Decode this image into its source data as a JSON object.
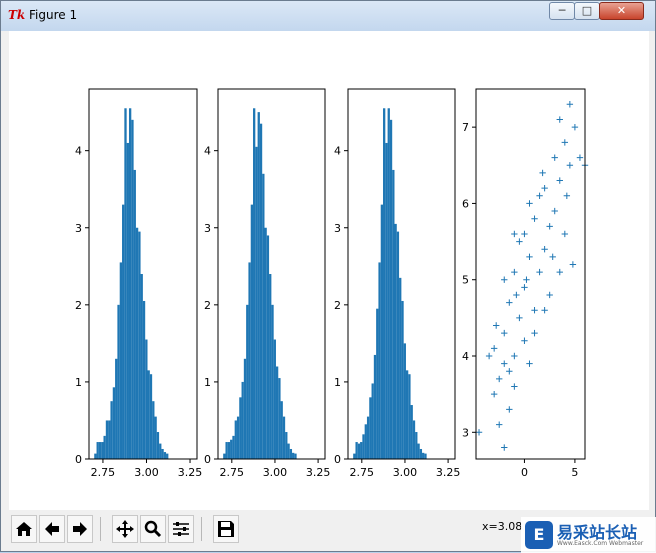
{
  "window": {
    "title": "Figure 1",
    "app_icon": "Tk",
    "buttons": {
      "minimize": "─",
      "maximize": "□",
      "close": "✕"
    }
  },
  "toolbar": {
    "icons": [
      "home-icon",
      "back-arrow-icon",
      "forward-arrow-icon",
      "pan-icon",
      "zoom-icon",
      "configure-subplots-icon",
      "save-icon"
    ],
    "coords": "x=3.08"
  },
  "watermark": {
    "logo": "E",
    "text": "易采站长站",
    "subtext": "Www.Easck.Com Webmaster"
  },
  "colors": {
    "bar": "#1f77b4",
    "marker": "#1f77b4"
  },
  "chart_data": [
    {
      "type": "bar",
      "title": "",
      "xlabel": "",
      "ylabel": "",
      "xlim": [
        2.67,
        3.29
      ],
      "ylim": [
        0,
        4.8
      ],
      "xticks": [
        "2.75",
        "3.00",
        "3.25"
      ],
      "yticks": [
        "0",
        "1",
        "2",
        "3",
        "4"
      ],
      "bin_start": 2.7,
      "bin_width": 0.0133,
      "values": [
        0.07,
        0.22,
        0.22,
        0.22,
        0.3,
        0.5,
        0.5,
        0.75,
        0.93,
        1.3,
        2.0,
        2.55,
        3.3,
        4.55,
        4.1,
        4.55,
        4.4,
        3.75,
        3.0,
        2.95,
        2.4,
        2.05,
        1.55,
        1.15,
        1.1,
        0.75,
        0.55,
        0.35,
        0.2,
        0.13,
        0.09,
        0.07
      ]
    },
    {
      "type": "bar",
      "title": "",
      "xlabel": "",
      "ylabel": "",
      "xlim": [
        2.67,
        3.29
      ],
      "ylim": [
        0,
        4.8
      ],
      "xticks": [
        "2.75",
        "3.00",
        "3.25"
      ],
      "yticks": [
        "0",
        "1",
        "2",
        "3",
        "4"
      ],
      "bin_start": 2.7,
      "bin_width": 0.0133,
      "values": [
        0.07,
        0.22,
        0.22,
        0.25,
        0.3,
        0.5,
        0.55,
        0.8,
        1.0,
        1.3,
        2.0,
        2.55,
        3.3,
        4.55,
        4.05,
        4.5,
        4.35,
        3.7,
        3.0,
        2.9,
        2.4,
        2.0,
        1.55,
        1.2,
        1.05,
        0.75,
        0.55,
        0.35,
        0.2,
        0.13,
        0.08,
        0.07
      ]
    },
    {
      "type": "bar",
      "title": "",
      "xlabel": "",
      "ylabel": "",
      "xlim": [
        2.67,
        3.29
      ],
      "ylim": [
        0,
        4.8
      ],
      "xticks": [
        "2.75",
        "3.00",
        "3.25"
      ],
      "yticks": [
        "0",
        "1",
        "2",
        "3",
        "4"
      ],
      "bin_start": 2.7,
      "bin_width": 0.0133,
      "values": [
        0.07,
        0.22,
        0.2,
        0.22,
        0.32,
        0.45,
        0.55,
        0.8,
        0.98,
        1.35,
        1.95,
        2.55,
        3.3,
        4.55,
        4.1,
        4.55,
        4.4,
        3.75,
        3.05,
        2.95,
        2.35,
        2.05,
        1.5,
        1.15,
        1.1,
        0.7,
        0.5,
        0.35,
        0.2,
        0.13,
        0.08,
        0.07
      ]
    },
    {
      "type": "scatter",
      "title": "",
      "xlabel": "",
      "ylabel": "",
      "marker": "+",
      "xlim": [
        -4.8,
        6.0
      ],
      "ylim": [
        2.65,
        7.5
      ],
      "xticks": [
        "0",
        "5"
      ],
      "yticks": [
        "3",
        "4",
        "5",
        "6",
        "7"
      ],
      "points": [
        [
          -4.5,
          3.0
        ],
        [
          -2.0,
          2.8
        ],
        [
          -2.5,
          3.1
        ],
        [
          -3.0,
          3.5
        ],
        [
          -2.5,
          3.7
        ],
        [
          -3.5,
          4.0
        ],
        [
          -3.0,
          4.1
        ],
        [
          -2.0,
          3.9
        ],
        [
          -1.5,
          3.3
        ],
        [
          -1.0,
          3.6
        ],
        [
          -2.0,
          4.3
        ],
        [
          -1.0,
          4.0
        ],
        [
          -0.5,
          4.5
        ],
        [
          0.0,
          4.2
        ],
        [
          -1.5,
          4.7
        ],
        [
          0.5,
          3.9
        ],
        [
          -1.0,
          5.1
        ],
        [
          0.0,
          4.9
        ],
        [
          1.0,
          4.6
        ],
        [
          0.5,
          5.3
        ],
        [
          -2.0,
          5.0
        ],
        [
          1.5,
          5.1
        ],
        [
          0.0,
          5.6
        ],
        [
          1.0,
          5.8
        ],
        [
          2.0,
          5.4
        ],
        [
          -1.0,
          5.6
        ],
        [
          0.5,
          6.0
        ],
        [
          1.5,
          6.1
        ],
        [
          2.5,
          5.7
        ],
        [
          3.0,
          5.9
        ],
        [
          2.0,
          6.2
        ],
        [
          3.5,
          6.3
        ],
        [
          4.0,
          5.6
        ],
        [
          3.0,
          6.6
        ],
        [
          4.5,
          6.5
        ],
        [
          4.0,
          6.8
        ],
        [
          5.0,
          7.0
        ],
        [
          4.5,
          7.3
        ],
        [
          3.5,
          7.1
        ],
        [
          5.5,
          6.6
        ],
        [
          6.0,
          6.5
        ],
        [
          4.8,
          5.2
        ],
        [
          2.5,
          4.8
        ],
        [
          -0.5,
          5.5
        ],
        [
          1.0,
          4.3
        ],
        [
          -1.5,
          3.8
        ],
        [
          2.0,
          4.6
        ],
        [
          3.5,
          5.1
        ],
        [
          4.2,
          6.1
        ],
        [
          1.8,
          6.4
        ],
        [
          0.2,
          5.0
        ],
        [
          -0.8,
          4.8
        ],
        [
          2.8,
          5.3
        ],
        [
          -2.8,
          4.4
        ]
      ]
    }
  ]
}
